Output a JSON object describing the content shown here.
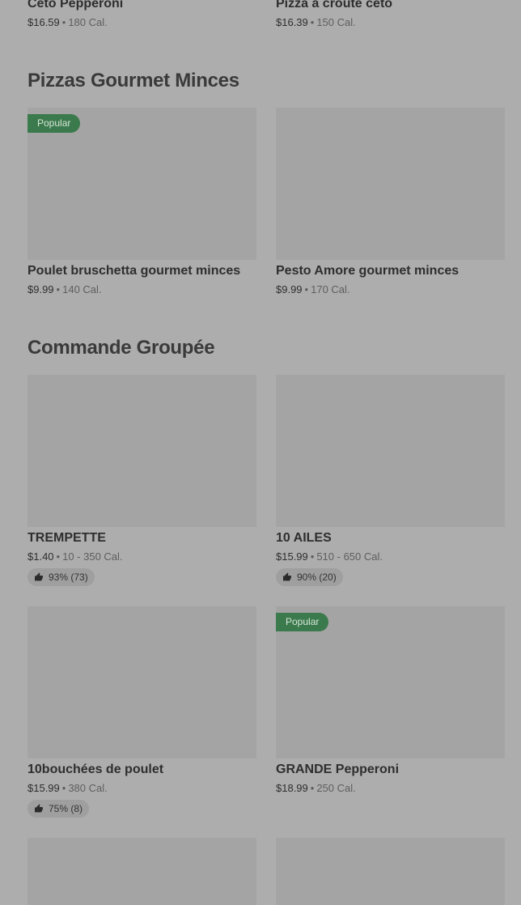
{
  "top_items": [
    {
      "name": "Céto Pepperoni",
      "price": "$16.59",
      "cal": "180 Cal."
    },
    {
      "name": "Pizza à croûte céto",
      "price": "$16.39",
      "cal": "150 Cal."
    }
  ],
  "sections": [
    {
      "title": "Pizzas Gourmet Minces",
      "items": [
        {
          "badge": "Popular",
          "name": "Poulet bruschetta gourmet minces",
          "price": "$9.99",
          "cal": "140 Cal."
        },
        {
          "name": "Pesto Amore gourmet minces",
          "price": "$9.99",
          "cal": "170 Cal."
        }
      ]
    },
    {
      "title": "Commande Groupée",
      "items": [
        {
          "name": "TREMPETTE",
          "price": "$1.40",
          "cal": "10 - 350 Cal.",
          "rating": "93% (73)"
        },
        {
          "name": "10 AILES",
          "price": "$15.99",
          "cal": "510 - 650 Cal.",
          "rating": "90% (20)"
        },
        {
          "name": "10bouchées de poulet",
          "price": "$15.99",
          "cal": "380 Cal.",
          "rating": "75% (8)"
        },
        {
          "badge": "Popular",
          "name": "GRANDE Pepperoni",
          "price": "$18.99",
          "cal": "250 Cal."
        }
      ]
    }
  ],
  "separator": "•",
  "icons": {
    "rating": "thumbs-up-icon"
  },
  "colors": {
    "badge_bg": "#3b7a4c",
    "background": "#adadad",
    "image_placeholder": "#a4a4a4"
  }
}
